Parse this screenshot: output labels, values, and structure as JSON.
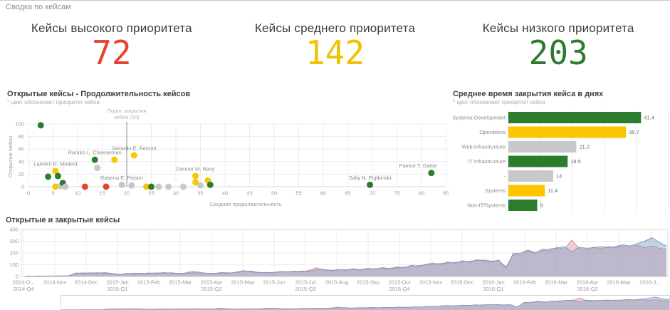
{
  "header": {
    "title": "Сводка по кейсам"
  },
  "kpis": [
    {
      "label": "Кейсы высокого приоритета",
      "value": "72",
      "color": "#e8432c"
    },
    {
      "label": "Кейсы среднего приоритета",
      "value": "142",
      "color": "#f0c200"
    },
    {
      "label": "Кейсы низкого приоритета",
      "value": "203",
      "color": "#2c7c2e"
    }
  ],
  "priority_colors": {
    "high": "#e8432c",
    "medium": "#fdc500",
    "low": "#2c7c2e",
    "none": "#c8c8c8"
  },
  "chart_data": [
    {
      "type": "scatter",
      "title": "Открытые кейсы - Продолжительность кейсов",
      "subtitle": "* цвет обозначает приоритет кейса",
      "xlabel": "Средняя продолжительность",
      "ylabel": "Открытые кейсы",
      "xlim": [
        0,
        87
      ],
      "xticks": [
        0,
        5,
        10,
        15,
        20,
        25,
        30,
        35,
        40,
        45,
        50,
        55,
        60,
        65,
        70,
        75,
        80,
        85
      ],
      "ylim": [
        0,
        100
      ],
      "yticks": [
        0,
        20,
        40,
        60,
        80,
        100
      ],
      "reference_line": {
        "x": 20,
        "label_line1": "Порог закрытия",
        "label_line2": "кейса (20)"
      },
      "points": [
        {
          "x": 2.5,
          "y": 98,
          "priority": "low"
        },
        {
          "x": 4,
          "y": 16,
          "priority": "low"
        },
        {
          "x": 5.5,
          "y": 25,
          "priority": "medium",
          "label": "Lamont R. Modest"
        },
        {
          "x": 6,
          "y": 17,
          "priority": "low"
        },
        {
          "x": 5.5,
          "y": 0,
          "priority": "medium"
        },
        {
          "x": 6.5,
          "y": 1,
          "priority": "none"
        },
        {
          "x": 7,
          "y": 6,
          "priority": "low"
        },
        {
          "x": 7.5,
          "y": 0,
          "priority": "none"
        },
        {
          "x": 11.5,
          "y": 0,
          "priority": "high"
        },
        {
          "x": 13.5,
          "y": 43,
          "priority": "low",
          "label": "Ramiro L. Cheeseman"
        },
        {
          "x": 14,
          "y": 30,
          "priority": "none"
        },
        {
          "x": 15.8,
          "y": 0,
          "priority": "high"
        },
        {
          "x": 17.5,
          "y": 43,
          "priority": "medium"
        },
        {
          "x": 19,
          "y": 3,
          "priority": "none",
          "label": "Robena E. Feister"
        },
        {
          "x": 21,
          "y": 2,
          "priority": "none"
        },
        {
          "x": 21.5,
          "y": 50,
          "priority": "medium",
          "label": "Gerardo E. Ferroni"
        },
        {
          "x": 24,
          "y": 0,
          "priority": "medium"
        },
        {
          "x": 25,
          "y": 0,
          "priority": "low"
        },
        {
          "x": 26.5,
          "y": 0,
          "priority": "none"
        },
        {
          "x": 28.5,
          "y": 0,
          "priority": "none"
        },
        {
          "x": 31.5,
          "y": 0,
          "priority": "none"
        },
        {
          "x": 34,
          "y": 17,
          "priority": "medium",
          "label": "Denver M. Navy"
        },
        {
          "x": 34,
          "y": 7,
          "priority": "medium"
        },
        {
          "x": 35,
          "y": 2,
          "priority": "none"
        },
        {
          "x": 36.5,
          "y": 10,
          "priority": "medium"
        },
        {
          "x": 37,
          "y": 3,
          "priority": "low"
        },
        {
          "x": 69.5,
          "y": 3,
          "priority": "low",
          "label": "Sally N. Pujtkinski"
        },
        {
          "x": 82,
          "y": 22,
          "priority": "low",
          "label": "Patrice T. Gattie"
        }
      ]
    },
    {
      "type": "bar",
      "orientation": "horizontal",
      "title": "Среднее время закрытия кейса в днях",
      "subtitle": "* цвет обозначает приоритет кейса",
      "categories": [
        "Systems Development",
        "Operations",
        "Web Infrastructure",
        "IT Infrastructure",
        "-",
        "Systems",
        "Non-IT/Systems"
      ],
      "values": [
        41.4,
        36.7,
        21.2,
        18.5,
        14,
        11.4,
        9
      ],
      "value_labels": [
        "41.4",
        "36.7",
        "21.2",
        "18.5",
        "14",
        "11.4",
        "9"
      ],
      "bar_priorities": [
        "low",
        "medium",
        "none",
        "low",
        "none",
        "medium",
        "low"
      ],
      "xlim": [
        0,
        50
      ]
    },
    {
      "type": "area",
      "title": "Открытые и закрытые кейсы",
      "ylim": [
        0,
        400
      ],
      "yticks": [
        0,
        100,
        200,
        300,
        400
      ],
      "month_labels": [
        "2014-O...",
        "2014-Nov",
        "2014-Dec",
        "2015-Jan",
        "2015-Feb",
        "2015-Mar",
        "2015-Apr",
        "2015-May",
        "2015-Jun",
        "2015-Jul",
        "2015-Aug",
        "2015-Sep",
        "2015-Oct",
        "2015-Nov",
        "2015-Dec",
        "2016-Jan",
        "2016-Feb",
        "2016-Mar",
        "2016-Apr",
        "2016-May",
        "2016-J..."
      ],
      "quarter_labels": [
        {
          "label": "2014-Q4",
          "month_index": 0
        },
        {
          "label": "2015-Q1",
          "month_index": 3
        },
        {
          "label": "2015-Q2",
          "month_index": 6
        },
        {
          "label": "2015-Q3",
          "month_index": 9
        },
        {
          "label": "2015-Q4",
          "month_index": 12
        },
        {
          "label": "2016-Q1",
          "month_index": 15
        },
        {
          "label": "2016-Q2",
          "month_index": 18
        }
      ],
      "series": [
        {
          "name": "Открытые",
          "line_color": "#d2909b",
          "fill_color": "rgba(226,156,166,0.5)",
          "values": [
            3,
            2,
            4,
            3,
            5,
            4,
            6,
            30,
            26,
            32,
            28,
            34,
            24,
            15,
            22,
            28,
            24,
            30,
            26,
            34,
            28,
            22,
            30,
            45,
            36,
            26,
            24,
            30,
            26,
            38,
            50,
            40,
            32,
            36,
            30,
            44,
            38,
            46,
            40,
            52,
            75,
            55,
            48,
            60,
            52,
            66,
            58,
            70,
            62,
            76,
            68,
            82,
            74,
            95,
            85,
            105,
            115,
            100,
            125,
            110,
            135,
            120,
            145,
            130,
            125,
            140,
            70,
            200,
            180,
            215,
            195,
            235,
            215,
            250,
            230,
            310,
            240,
            225,
            250,
            235,
            255,
            245,
            260,
            250,
            265,
            245,
            260,
            240,
            230
          ]
        },
        {
          "name": "Закрытые",
          "line_color": "#7d9cbf",
          "fill_color": "rgba(126,160,196,0.45)",
          "values": [
            2,
            3,
            2,
            4,
            3,
            5,
            4,
            26,
            30,
            28,
            32,
            28,
            26,
            18,
            26,
            24,
            28,
            26,
            30,
            28,
            32,
            26,
            28,
            32,
            30,
            28,
            26,
            34,
            30,
            34,
            44,
            46,
            36,
            32,
            34,
            38,
            42,
            40,
            46,
            44,
            55,
            60,
            52,
            56,
            58,
            60,
            54,
            64,
            66,
            70,
            62,
            74,
            78,
            88,
            92,
            98,
            105,
            110,
            115,
            120,
            125,
            130,
            135,
            140,
            130,
            135,
            80,
            190,
            200,
            225,
            205,
            220,
            235,
            240,
            255,
            210,
            250,
            240,
            245,
            255,
            245,
            255,
            270,
            260,
            280,
            300,
            330,
            290,
            260
          ]
        }
      ]
    }
  ]
}
